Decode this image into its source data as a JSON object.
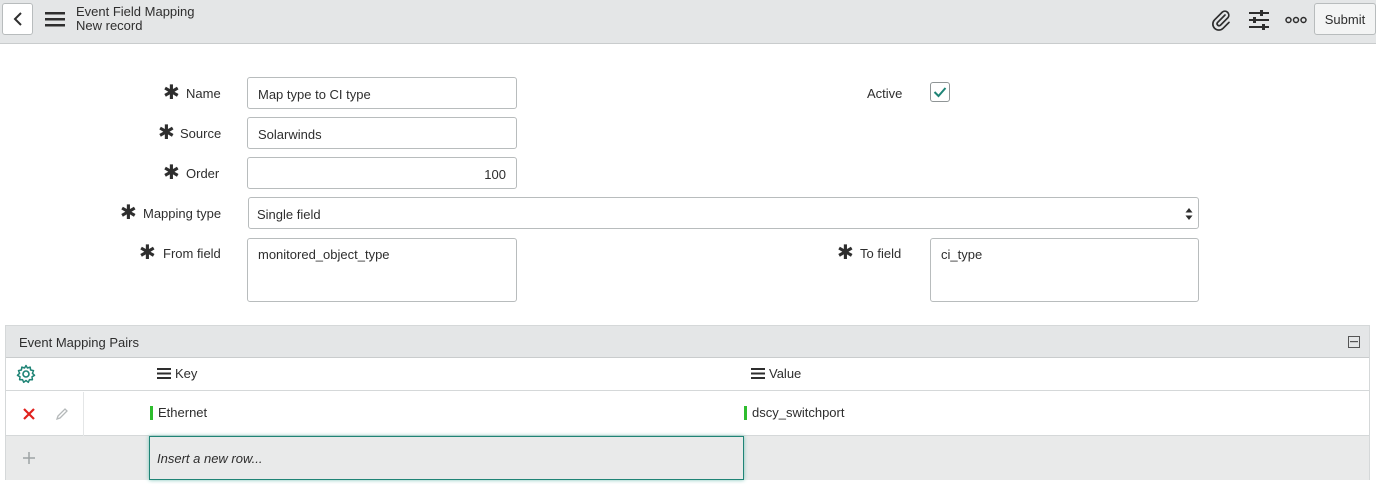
{
  "header": {
    "title": "Event Field Mapping",
    "subtitle": "New record",
    "submit_label": "Submit"
  },
  "form": {
    "name_label": "Name",
    "name_value": "Map type to CI type",
    "source_label": "Source",
    "source_value": "Solarwinds",
    "order_label": "Order",
    "order_value": "100",
    "mapping_type_label": "Mapping type",
    "mapping_type_value": "Single field",
    "from_field_label": "From field",
    "from_field_value": "monitored_object_type",
    "to_field_label": "To field",
    "to_field_value": "ci_type",
    "active_label": "Active",
    "active_checked": true
  },
  "related_list": {
    "title": "Event Mapping Pairs",
    "columns": [
      "Key",
      "Value"
    ],
    "rows": [
      {
        "key": "Ethernet",
        "value": "dscy_switchport"
      }
    ],
    "insert_placeholder": "Insert a new row..."
  },
  "icons": {
    "back": "chevron-left-icon",
    "menu": "hamburger-icon",
    "attach": "paperclip-icon",
    "settings": "sliders-icon",
    "more": "more-icon",
    "gear": "gear-icon",
    "delete": "x-icon",
    "edit": "pencil-icon",
    "add": "plus-icon"
  },
  "colors": {
    "header_bg": "#e4e6e7",
    "accent": "#1f8476",
    "delete": "#e0211d",
    "key_marker": "#2ebd2e"
  }
}
